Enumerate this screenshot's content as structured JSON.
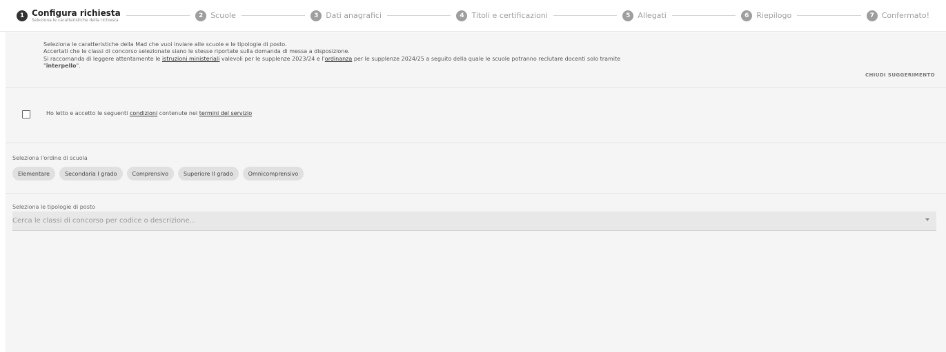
{
  "stepper": {
    "steps": [
      {
        "num": "1",
        "label": "Configura richiesta",
        "sub": "Seleziona le caratteristiche della richiesta"
      },
      {
        "num": "2",
        "label": "Scuole"
      },
      {
        "num": "3",
        "label": "Dati anagrafici"
      },
      {
        "num": "4",
        "label": "Titoli e certificazioni"
      },
      {
        "num": "5",
        "label": "Allegati"
      },
      {
        "num": "6",
        "label": "Riepilogo"
      },
      {
        "num": "7",
        "label": "Confermato!"
      }
    ]
  },
  "hint": {
    "line1": "Seleziona le caratteristiche della Mad che vuoi inviare alle scuole e le tipologie di posto.",
    "line2": "Accertati che le classi di concorso selezionate siano le stesse riportate sulla domanda di messa a disposizione.",
    "line3_a": "Si raccomanda di leggere attentamente le ",
    "link_istruzioni": "istruzioni ministeriali",
    "line3_b": " valevoli per le supplenze 2023/24 e l'",
    "link_ordinanza": "ordinanza",
    "line3_c": " per le supplenze 2024/25 a seguito della quale le scuole potranno reclutare docenti solo tramite",
    "line4_a": "\"",
    "line4_bold": "interpello",
    "line4_b": "\".",
    "close_label": "CHIUDI SUGGERIMENTO"
  },
  "terms": {
    "text_a": "Ho letto e accetto le seguenti ",
    "link_condizioni": "condizioni",
    "text_b": " contenute nei ",
    "link_termini": "termini del servizio"
  },
  "school": {
    "label": "Seleziona l'ordine di scuola",
    "options": [
      "Elementare",
      "Secondaria I grado",
      "Comprensivo",
      "Superiore II grado",
      "Omnicomprensivo"
    ]
  },
  "posto": {
    "label": "Seleziona le tipologie di posto",
    "placeholder": "Cerca le classi di concorso per codice o descrizione..."
  }
}
